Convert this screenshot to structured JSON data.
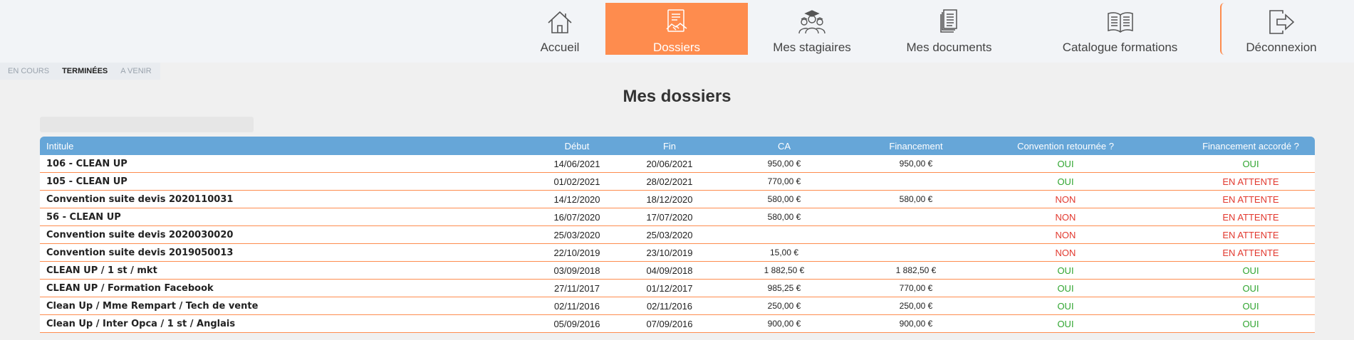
{
  "nav": {
    "items": [
      {
        "id": "accueil",
        "label": "Accueil",
        "icon": "home-icon"
      },
      {
        "id": "dossiers",
        "label": "Dossiers",
        "icon": "handshake-document-icon",
        "active": true
      },
      {
        "id": "stagiaires",
        "label": "Mes stagiaires",
        "icon": "graduates-icon"
      },
      {
        "id": "documents",
        "label": "Mes documents",
        "icon": "documents-icon"
      },
      {
        "id": "catalogue",
        "label": "Catalogue formations",
        "icon": "open-book-icon"
      },
      {
        "id": "deconnexion",
        "label": "Déconnexion",
        "icon": "logout-icon"
      }
    ],
    "accent_color": "#fe8c4e"
  },
  "subtabs": [
    {
      "label": "EN COURS",
      "active": false
    },
    {
      "label": "TERMINÉES",
      "active": true
    },
    {
      "label": "A VENIR",
      "active": false
    }
  ],
  "page": {
    "title": "Mes dossiers",
    "search_placeholder": ""
  },
  "table": {
    "header_color": "#66a6d8",
    "columns": [
      "Intitule",
      "Début",
      "Fin",
      "CA",
      "Financement",
      "Convention retournée ?",
      "Financement accordé ?"
    ],
    "rows": [
      {
        "intitule": "106 - CLEAN UP",
        "debut": "14/06/2021",
        "fin": "20/06/2021",
        "ca": "950,00 €",
        "financement": "950,00 €",
        "convention": "OUI",
        "accorde": "OUI"
      },
      {
        "intitule": "105 - CLEAN UP",
        "debut": "01/02/2021",
        "fin": "28/02/2021",
        "ca": "770,00 €",
        "financement": "",
        "convention": "OUI",
        "accorde": "EN ATTENTE"
      },
      {
        "intitule": "Convention suite devis 2020110031",
        "debut": "14/12/2020",
        "fin": "18/12/2020",
        "ca": "580,00 €",
        "financement": "580,00 €",
        "convention": "NON",
        "accorde": "EN ATTENTE"
      },
      {
        "intitule": "56 - CLEAN UP",
        "debut": "16/07/2020",
        "fin": "17/07/2020",
        "ca": "580,00 €",
        "financement": "",
        "convention": "NON",
        "accorde": "EN ATTENTE"
      },
      {
        "intitule": "Convention suite devis 2020030020",
        "debut": "25/03/2020",
        "fin": "25/03/2020",
        "ca": "",
        "financement": "",
        "convention": "NON",
        "accorde": "EN ATTENTE"
      },
      {
        "intitule": "Convention suite devis 2019050013",
        "debut": "22/10/2019",
        "fin": "23/10/2019",
        "ca": "15,00 €",
        "financement": "",
        "convention": "NON",
        "accorde": "EN ATTENTE"
      },
      {
        "intitule": "CLEAN UP / 1 st / mkt",
        "debut": "03/09/2018",
        "fin": "04/09/2018",
        "ca": "1 882,50 €",
        "financement": "1 882,50 €",
        "convention": "OUI",
        "accorde": "OUI"
      },
      {
        "intitule": "CLEAN UP / Formation Facebook",
        "debut": "27/11/2017",
        "fin": "01/12/2017",
        "ca": "985,25 €",
        "financement": "770,00 €",
        "convention": "OUI",
        "accorde": "OUI"
      },
      {
        "intitule": "Clean Up / Mme Rempart / Tech de vente",
        "debut": "02/11/2016",
        "fin": "02/11/2016",
        "ca": "250,00 €",
        "financement": "250,00 €",
        "convention": "OUI",
        "accorde": "OUI"
      },
      {
        "intitule": "Clean Up / Inter Opca / 1 st / Anglais",
        "debut": "05/09/2016",
        "fin": "07/09/2016",
        "ca": "900,00 €",
        "financement": "900,00 €",
        "convention": "OUI",
        "accorde": "OUI"
      }
    ]
  },
  "status_colors": {
    "positive": "#2fa52f",
    "negative": "#e2392f"
  }
}
